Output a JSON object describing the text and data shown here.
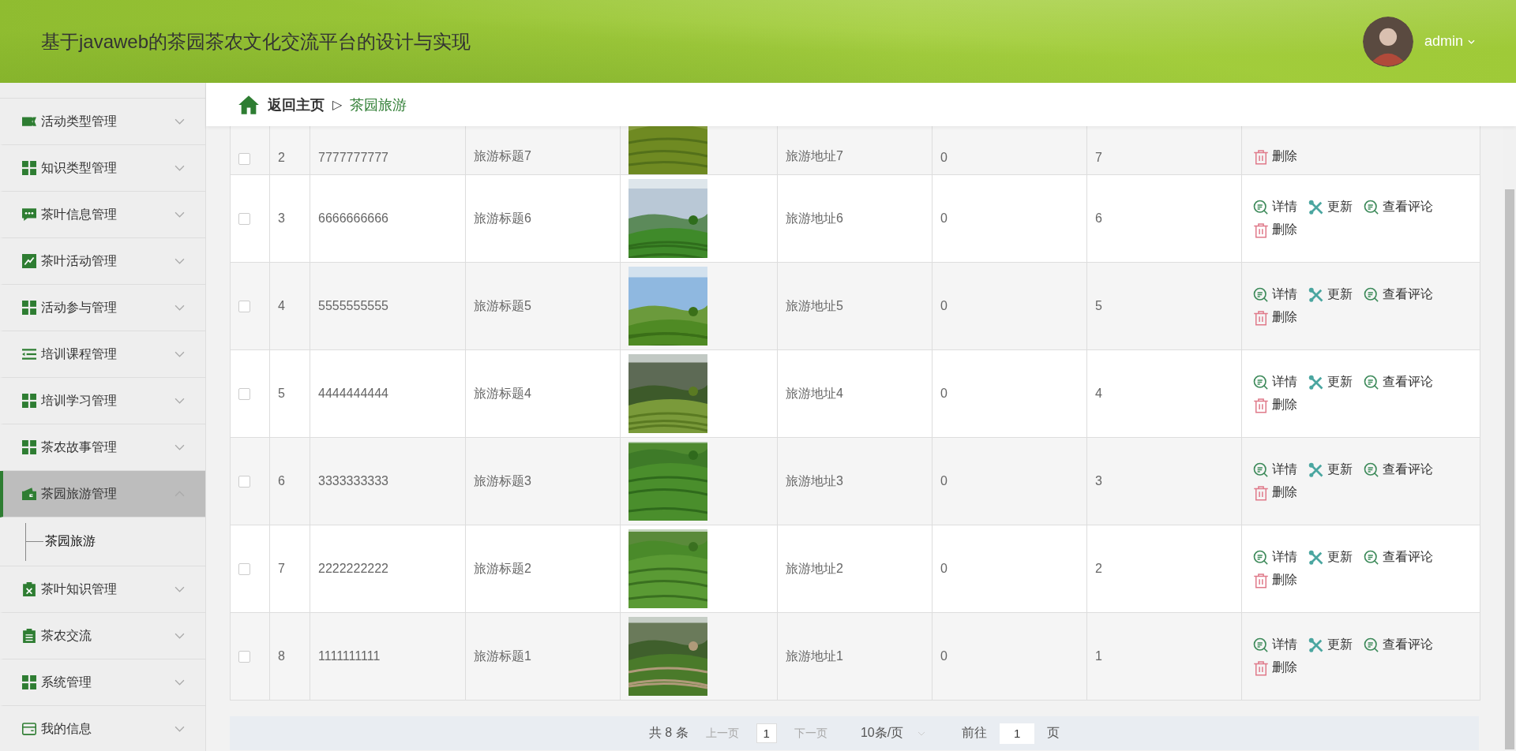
{
  "header": {
    "title": "基于javaweb的茶园茶农文化交流平台的设计与实现",
    "user": "admin"
  },
  "breadcrumb": {
    "home": "返回主页",
    "separator": "▷",
    "current": "茶园旅游"
  },
  "sidebar": {
    "items": [
      {
        "label": "活动类型管理",
        "expanded": false,
        "selected": false
      },
      {
        "label": "知识类型管理",
        "expanded": false,
        "selected": false
      },
      {
        "label": "茶叶信息管理",
        "expanded": false,
        "selected": false
      },
      {
        "label": "茶叶活动管理",
        "expanded": false,
        "selected": false
      },
      {
        "label": "活动参与管理",
        "expanded": false,
        "selected": false
      },
      {
        "label": "培训课程管理",
        "expanded": false,
        "selected": false
      },
      {
        "label": "培训学习管理",
        "expanded": false,
        "selected": false
      },
      {
        "label": "茶农故事管理",
        "expanded": false,
        "selected": false
      },
      {
        "label": "茶园旅游管理",
        "expanded": true,
        "selected": true,
        "children": [
          {
            "label": "茶园旅游",
            "selected": true
          }
        ]
      },
      {
        "label": "茶叶知识管理",
        "expanded": false,
        "selected": false
      },
      {
        "label": "茶农交流",
        "expanded": false,
        "selected": false
      },
      {
        "label": "系统管理",
        "expanded": false,
        "selected": false
      },
      {
        "label": "我的信息",
        "expanded": false,
        "selected": false
      }
    ]
  },
  "table": {
    "rows": [
      {
        "checked": false,
        "index": "2",
        "column_3": "7777777777",
        "column_4": "旅游标题7",
        "column_6": "旅游地址7",
        "column_7": "0",
        "column_8": "7",
        "actions": [
          {
            "kind": "delete",
            "label": "删除"
          }
        ]
      },
      {
        "checked": false,
        "index": "3",
        "column_3": "6666666666",
        "column_4": "旅游标题6",
        "column_6": "旅游地址6",
        "column_7": "0",
        "column_8": "6",
        "actions": [
          {
            "kind": "detail",
            "label": "详情"
          },
          {
            "kind": "update",
            "label": "更新"
          },
          {
            "kind": "detail",
            "label": "查看评论"
          },
          {
            "kind": "delete",
            "label": "删除"
          }
        ]
      },
      {
        "checked": false,
        "index": "4",
        "column_3": "5555555555",
        "column_4": "旅游标题5",
        "column_6": "旅游地址5",
        "column_7": "0",
        "column_8": "5",
        "actions": [
          {
            "kind": "detail",
            "label": "详情"
          },
          {
            "kind": "update",
            "label": "更新"
          },
          {
            "kind": "detail",
            "label": "查看评论"
          },
          {
            "kind": "delete",
            "label": "删除"
          }
        ]
      },
      {
        "checked": false,
        "index": "5",
        "column_3": "4444444444",
        "column_4": "旅游标题4",
        "column_6": "旅游地址4",
        "column_7": "0",
        "column_8": "4",
        "actions": [
          {
            "kind": "detail",
            "label": "详情"
          },
          {
            "kind": "update",
            "label": "更新"
          },
          {
            "kind": "detail",
            "label": "查看评论"
          },
          {
            "kind": "delete",
            "label": "删除"
          }
        ]
      },
      {
        "checked": false,
        "index": "6",
        "column_3": "3333333333",
        "column_4": "旅游标题3",
        "column_6": "旅游地址3",
        "column_7": "0",
        "column_8": "3",
        "actions": [
          {
            "kind": "detail",
            "label": "详情"
          },
          {
            "kind": "update",
            "label": "更新"
          },
          {
            "kind": "detail",
            "label": "查看评论"
          },
          {
            "kind": "delete",
            "label": "删除"
          }
        ]
      },
      {
        "checked": false,
        "index": "7",
        "column_3": "2222222222",
        "column_4": "旅游标题2",
        "column_6": "旅游地址2",
        "column_7": "0",
        "column_8": "2",
        "actions": [
          {
            "kind": "detail",
            "label": "详情"
          },
          {
            "kind": "update",
            "label": "更新"
          },
          {
            "kind": "detail",
            "label": "查看评论"
          },
          {
            "kind": "delete",
            "label": "删除"
          }
        ]
      },
      {
        "checked": false,
        "index": "8",
        "column_3": "1111111111",
        "column_4": "旅游标题1",
        "column_6": "旅游地址1",
        "column_7": "0",
        "column_8": "1",
        "actions": [
          {
            "kind": "detail",
            "label": "详情"
          },
          {
            "kind": "update",
            "label": "更新"
          },
          {
            "kind": "detail",
            "label": "查看评论"
          },
          {
            "kind": "delete",
            "label": "删除"
          }
        ]
      }
    ]
  },
  "pagination": {
    "total": "共 8 条",
    "prev": "上一页",
    "page": "1",
    "next": "下一页",
    "page_size": "10条/页",
    "goto": "前往",
    "goto_value": "1",
    "goto_suffix": "页"
  }
}
